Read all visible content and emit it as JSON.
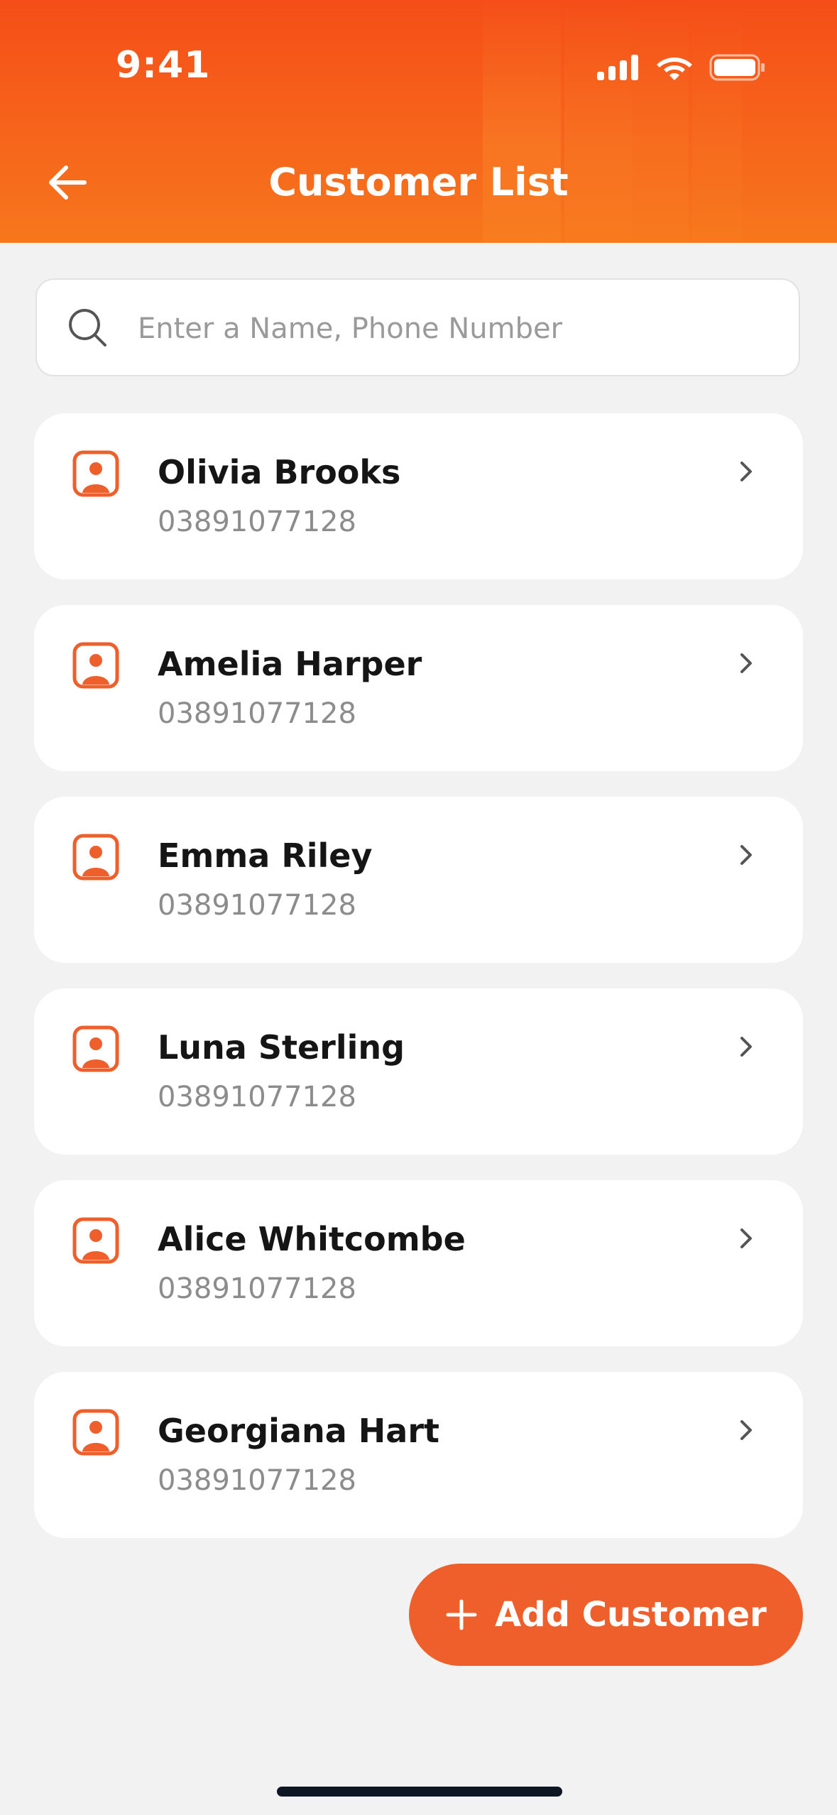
{
  "status_bar": {
    "time": "9:41",
    "icons": [
      "cellular-signal-icon",
      "wifi-icon",
      "battery-icon"
    ]
  },
  "header": {
    "title": "Customer List",
    "back_icon": "arrow-left-icon"
  },
  "search": {
    "placeholder": "Enter a Name, Phone Number",
    "value": "",
    "icon": "search-icon"
  },
  "customers": [
    {
      "name": "Olivia Brooks",
      "phone": "03891077128"
    },
    {
      "name": "Amelia Harper",
      "phone": "03891077128"
    },
    {
      "name": "Emma Riley",
      "phone": "03891077128"
    },
    {
      "name": "Luna Sterling",
      "phone": "03891077128"
    },
    {
      "name": "Alice Whitcombe",
      "phone": "03891077128"
    },
    {
      "name": "Georgiana Hart",
      "phone": "03891077128"
    }
  ],
  "add_button": {
    "label": "Add Customer",
    "icon": "plus-icon"
  },
  "colors": {
    "accent": "#ee5f2b",
    "header_top": "#f54e18",
    "header_bottom": "#f7771c",
    "background": "#f2f2f2",
    "name_text": "#151515",
    "phone_text": "#8c8c8c"
  }
}
